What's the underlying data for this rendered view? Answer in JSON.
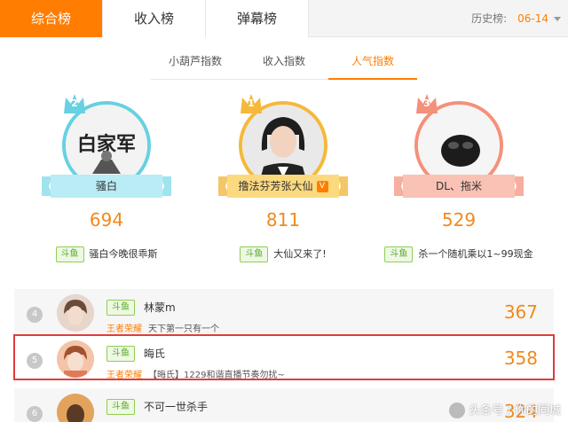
{
  "tabs": [
    {
      "label": "综合榜",
      "active": true
    },
    {
      "label": "收入榜",
      "active": false
    },
    {
      "label": "弹幕榜",
      "active": false
    }
  ],
  "history": {
    "label": "历史榜:",
    "date": "06-14"
  },
  "subtabs": [
    {
      "label": "小葫芦指数",
      "active": false
    },
    {
      "label": "收入指数",
      "active": false
    },
    {
      "label": "人气指数",
      "active": true
    }
  ],
  "podium": [
    {
      "rank": "2",
      "name": "骚白",
      "score": "694",
      "platform": "斗鱼",
      "desc": "骚白今晚很乖斯",
      "avatar_text": "白家军",
      "ring_color": "#66d1e2"
    },
    {
      "rank": "1",
      "name": "撸法芬芳张大仙",
      "verified_badge": "V",
      "score": "811",
      "platform": "斗鱼",
      "desc": "大仙又来了!",
      "ring_color": "#f5b83a"
    },
    {
      "rank": "3",
      "name": "DL、拖米",
      "score": "529",
      "platform": "斗鱼",
      "desc": "杀一个随机乘以1~99现金",
      "ring_color": "#f5907a"
    }
  ],
  "list": [
    {
      "rank": "4",
      "platform": "斗鱼",
      "name": "林蒙m",
      "game": "王者荣耀",
      "desc": "天下第一只有一个",
      "score": "367"
    },
    {
      "rank": "5",
      "platform": "斗鱼",
      "name": "晦氏",
      "game": "王者荣耀",
      "desc": "【晦氏】1229和谐直播节奏勿扰~",
      "score": "358"
    },
    {
      "rank": "6",
      "platform": "斗鱼",
      "name": "不可一世杀手",
      "game": "",
      "desc": "",
      "score": "324"
    }
  ],
  "watermark": "头条号 / 你的同城",
  "colors": {
    "accent": "#ff7d00",
    "score": "#f08a1d",
    "highlight": "#e23b3b"
  }
}
